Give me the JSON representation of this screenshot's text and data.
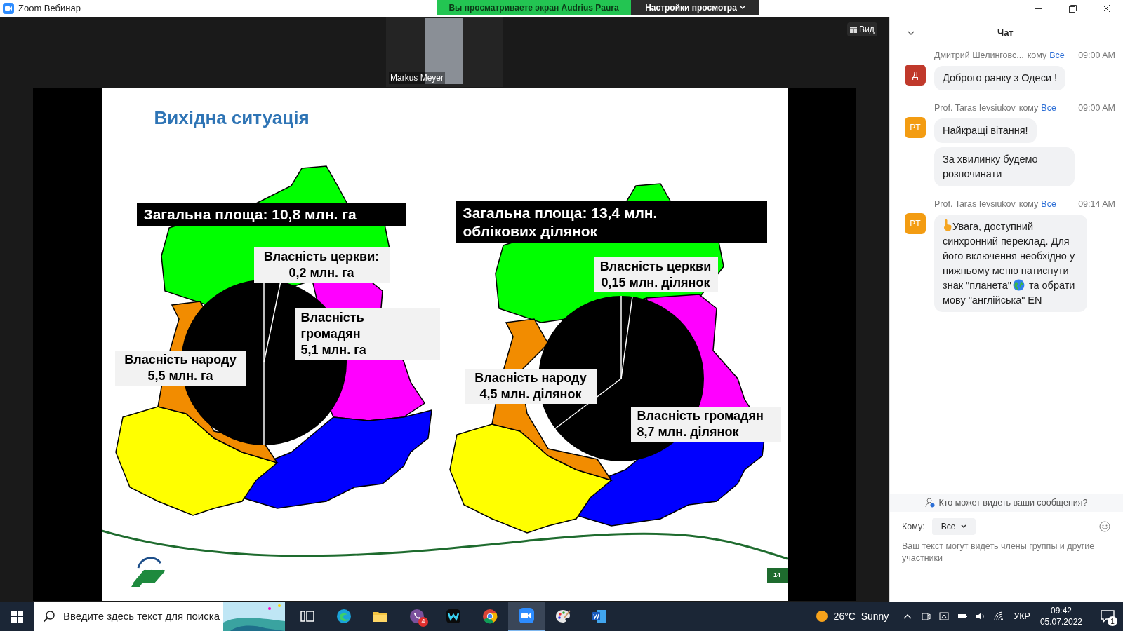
{
  "window": {
    "title": "Zoom Вебинар"
  },
  "banner": {
    "text": "Вы просматриваете экран Audrius Paura",
    "settings_button": "Настройки просмотра"
  },
  "video_tile": {
    "name": "Markus Meyer"
  },
  "view_button": "Вид",
  "slide": {
    "title": "Вихідна ситуація",
    "maps": [
      {
        "total": [
          "Загальна площа: 10,8 млн. га"
        ],
        "labels": [
          {
            "lines": [
              "Власність церкви:",
              "0,2  млн. га"
            ]
          },
          {
            "lines": [
              "Власність",
              "громадян",
              "5,1 млн. га"
            ]
          },
          {
            "lines": [
              "Власність народу",
              "5,5 млн. га"
            ]
          }
        ]
      },
      {
        "total": [
          "Загальна площа: 13,4 млн.",
          "облікових ділянок"
        ],
        "labels": [
          {
            "lines": [
              "Власність церкви",
              "0,15 млн. ділянок"
            ]
          },
          {
            "lines": [
              "Власність народу",
              "4,5 млн. ділянок"
            ]
          },
          {
            "lines": [
              "Власність громадян",
              "8,7 млн. ділянок"
            ]
          }
        ]
      }
    ],
    "page": "14"
  },
  "chat": {
    "title": "Чат",
    "messages": [
      {
        "avatar": "Д",
        "color": "#c0392b",
        "sender": "Дмитрий Шелинговс...",
        "to_word": "кому",
        "recipient": "Все",
        "time": "09:00 AM",
        "bubbles": [
          {
            "parts": [
              "Доброго ранку з Одеси !"
            ]
          }
        ]
      },
      {
        "avatar": "PT",
        "color": "#f39c12",
        "sender": "Prof. Taras Ievsiukov",
        "to_word": "кому",
        "recipient": "Все",
        "time": "09:00 AM",
        "bubbles": [
          {
            "parts": [
              "Найкращі вітання!"
            ]
          },
          {
            "parts": [
              "За хвилинку будемо розпочинати"
            ]
          }
        ]
      },
      {
        "avatar": "PT",
        "color": "#f39c12",
        "sender": "Prof. Taras Ievsiukov",
        "to_word": "кому",
        "recipient": "Все",
        "time": "09:14 AM",
        "bubbles": [
          {
            "parts": [
              "Увага, доступний синхронний переклад. Для його включення необхідно у нижньому меню натиснути знак \"планета\"",
              "та обрати мову \"англійська\" EN"
            ]
          }
        ]
      }
    ],
    "privacy_note": "Кто может видеть ваши сообщения?",
    "to_label": "Кому:",
    "to_value": "Все",
    "input_placeholder": "Ваш текст могут видеть члены группы и другие участники"
  },
  "taskbar": {
    "search_placeholder": "Введите здесь текст для поиска",
    "apps": [
      {
        "kind": "taskview",
        "selected": false
      },
      {
        "kind": "edge",
        "selected": false
      },
      {
        "kind": "explorer",
        "selected": false
      },
      {
        "kind": "viber",
        "selected": false,
        "badge": "4"
      },
      {
        "kind": "webex",
        "selected": false
      },
      {
        "kind": "chrome",
        "selected": false
      },
      {
        "kind": "zoom",
        "selected": true
      },
      {
        "kind": "paint",
        "selected": false
      },
      {
        "kind": "word",
        "selected": false
      }
    ],
    "weather": "26°C  Sunny",
    "language": "УКР",
    "time": "09:42",
    "date": "05.07.2022",
    "notifications": "1"
  }
}
